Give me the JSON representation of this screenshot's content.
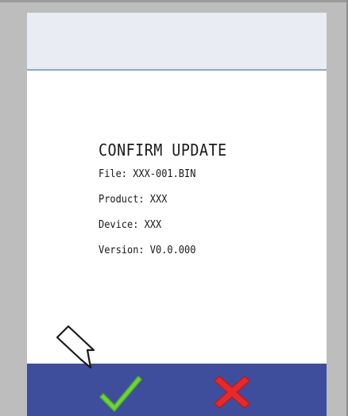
{
  "dialog": {
    "title": "CONFIRM UPDATE",
    "file": "File: XXX-001.BIN",
    "product": "Product: XXX",
    "device": "Device: XXX",
    "version": "Version: V0.0.000"
  },
  "footer": {
    "confirm_icon": "checkmark-icon",
    "cancel_icon": "x-icon"
  },
  "colors": {
    "footer_bg": "#3e4e9c",
    "confirm_green": "#6fd33a",
    "cancel_red": "#e8282a",
    "header_bg": "#e9ecf3"
  }
}
